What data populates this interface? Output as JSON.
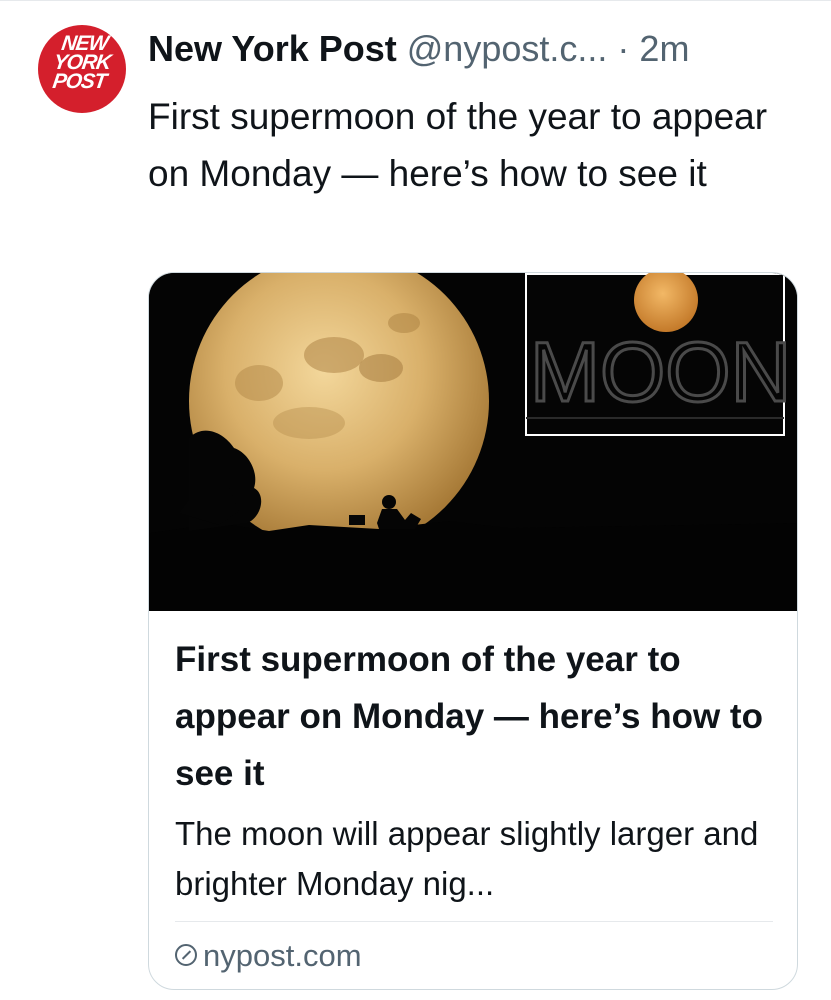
{
  "tweet": {
    "avatar_text": [
      "NEW",
      "YORK",
      "POST"
    ],
    "display_name": "New York Post",
    "handle": "@nypost.c...",
    "separator": "·",
    "time": "2m",
    "text": "First supermoon of the year to appear on Monday — here’s how to see it"
  },
  "card": {
    "image_overlay_text": "MOON",
    "title": "First supermoon of the year to appear on Monday — here’s how to see it",
    "description": "The moon will appear slightly larger and brighter Monday nig...",
    "domain": "nypost.com",
    "domain_icon": "link-icon"
  },
  "colors": {
    "text_primary": "#0f1419",
    "text_secondary": "#536471",
    "brand_red": "#d41f2c",
    "border": "#cfd9de"
  }
}
